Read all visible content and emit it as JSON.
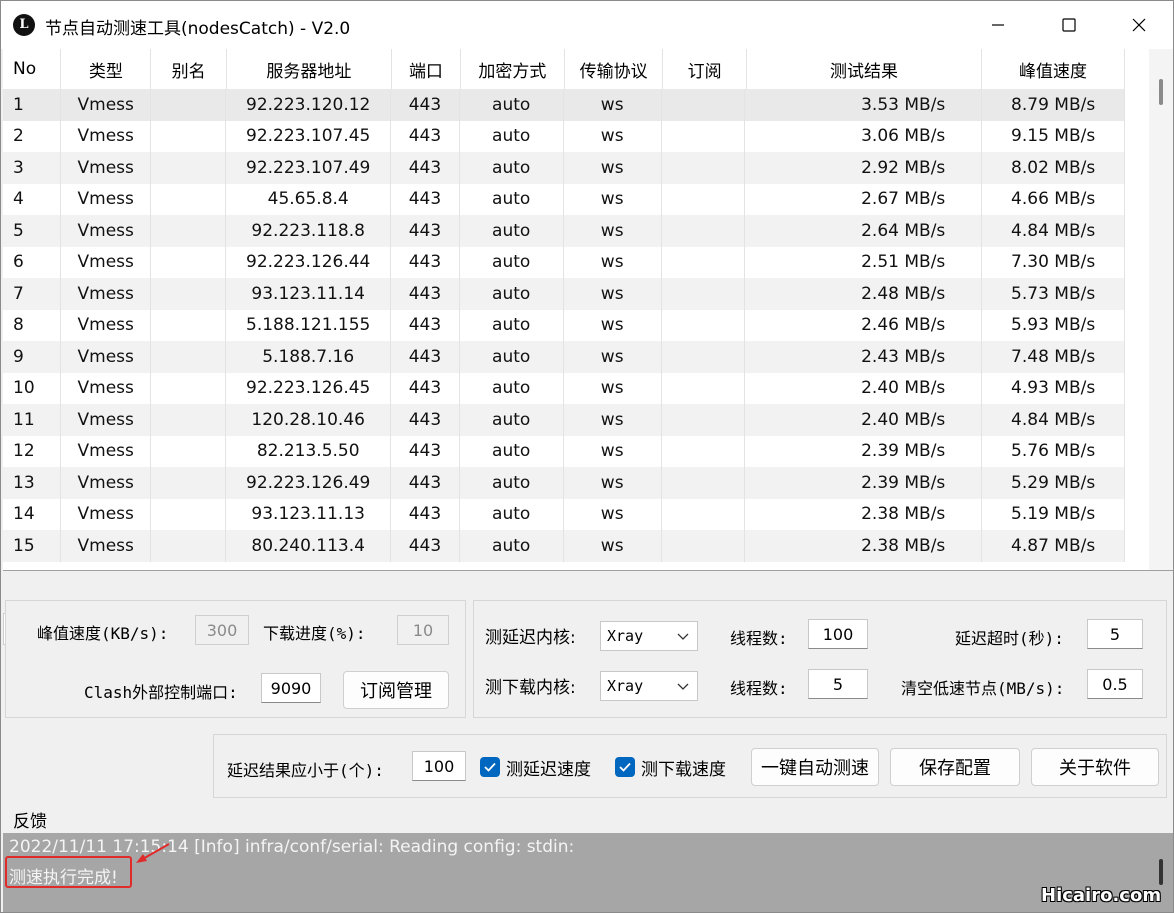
{
  "window": {
    "title": "节点自动测速工具(nodesCatch) - V2.0",
    "app_icon_letter": "L"
  },
  "table": {
    "columns": [
      "No",
      "类型",
      "别名",
      "服务器地址",
      "端口",
      "加密方式",
      "传输协议",
      "订阅",
      "测试结果",
      "峰值速度"
    ],
    "rows": [
      [
        "1",
        "Vmess",
        "",
        "92.223.120.12",
        "443",
        "auto",
        "ws",
        "",
        "3.53 MB/s",
        "8.79 MB/s"
      ],
      [
        "2",
        "Vmess",
        "",
        "92.223.107.45",
        "443",
        "auto",
        "ws",
        "",
        "3.06 MB/s",
        "9.15 MB/s"
      ],
      [
        "3",
        "Vmess",
        "",
        "92.223.107.49",
        "443",
        "auto",
        "ws",
        "",
        "2.92 MB/s",
        "8.02 MB/s"
      ],
      [
        "4",
        "Vmess",
        "",
        "45.65.8.4",
        "443",
        "auto",
        "ws",
        "",
        "2.67 MB/s",
        "4.66 MB/s"
      ],
      [
        "5",
        "Vmess",
        "",
        "92.223.118.8",
        "443",
        "auto",
        "ws",
        "",
        "2.64 MB/s",
        "4.84 MB/s"
      ],
      [
        "6",
        "Vmess",
        "",
        "92.223.126.44",
        "443",
        "auto",
        "ws",
        "",
        "2.51 MB/s",
        "7.30 MB/s"
      ],
      [
        "7",
        "Vmess",
        "",
        "93.123.11.14",
        "443",
        "auto",
        "ws",
        "",
        "2.48 MB/s",
        "5.73 MB/s"
      ],
      [
        "8",
        "Vmess",
        "",
        "5.188.121.155",
        "443",
        "auto",
        "ws",
        "",
        "2.46 MB/s",
        "5.93 MB/s"
      ],
      [
        "9",
        "Vmess",
        "",
        "5.188.7.16",
        "443",
        "auto",
        "ws",
        "",
        "2.43 MB/s",
        "7.48 MB/s"
      ],
      [
        "10",
        "Vmess",
        "",
        "92.223.126.45",
        "443",
        "auto",
        "ws",
        "",
        "2.40 MB/s",
        "4.93 MB/s"
      ],
      [
        "11",
        "Vmess",
        "",
        "120.28.10.46",
        "443",
        "auto",
        "ws",
        "",
        "2.40 MB/s",
        "4.84 MB/s"
      ],
      [
        "12",
        "Vmess",
        "",
        "82.213.5.50",
        "443",
        "auto",
        "ws",
        "",
        "2.39 MB/s",
        "5.76 MB/s"
      ],
      [
        "13",
        "Vmess",
        "",
        "92.223.126.49",
        "443",
        "auto",
        "ws",
        "",
        "2.39 MB/s",
        "5.29 MB/s"
      ],
      [
        "14",
        "Vmess",
        "",
        "93.123.11.13",
        "443",
        "auto",
        "ws",
        "",
        "2.38 MB/s",
        "5.19 MB/s"
      ],
      [
        "15",
        "Vmess",
        "",
        "80.240.113.4",
        "443",
        "auto",
        "ws",
        "",
        "2.38 MB/s",
        "4.87 MB/s"
      ]
    ]
  },
  "settings": {
    "peak_speed_label": "峰值速度(KB/s):",
    "peak_speed_value": "300",
    "download_progress_label": "下载进度(%):",
    "download_progress_value": "10",
    "clash_port_label": "Clash外部控制端口:",
    "clash_port_value": "9090",
    "subscription_button": "订阅管理",
    "latency_core_label": "测延迟内核:",
    "latency_core_value": "Xray",
    "latency_threads_label": "线程数:",
    "latency_threads_value": "100",
    "latency_timeout_label": "延迟超时(秒):",
    "latency_timeout_value": "5",
    "download_core_label": "测下载内核:",
    "download_core_value": "Xray",
    "download_threads_label": "线程数:",
    "download_threads_value": "5",
    "clear_slow_label": "清空低速节点(MB/s):",
    "clear_slow_value": "0.5"
  },
  "actions": {
    "latency_result_label": "延迟结果应小于(个):",
    "latency_result_value": "100",
    "test_latency_label": "测延迟速度",
    "test_latency_checked": true,
    "test_download_label": "测下载速度",
    "test_download_checked": true,
    "auto_test_button": "一键自动测速",
    "save_config_button": "保存配置",
    "about_button": "关于软件"
  },
  "log": {
    "section_label": "反馈",
    "lines": [
      "2022/11/11 17:15:14 [Info] infra/conf/serial: Reading config: stdin:",
      "测速执行完成!"
    ]
  },
  "watermark": "Hicairo.com",
  "colors": {
    "checkbox_accent": "#0067c0",
    "highlight_red": "#e02b2b",
    "log_background": "#a6a6a6"
  }
}
